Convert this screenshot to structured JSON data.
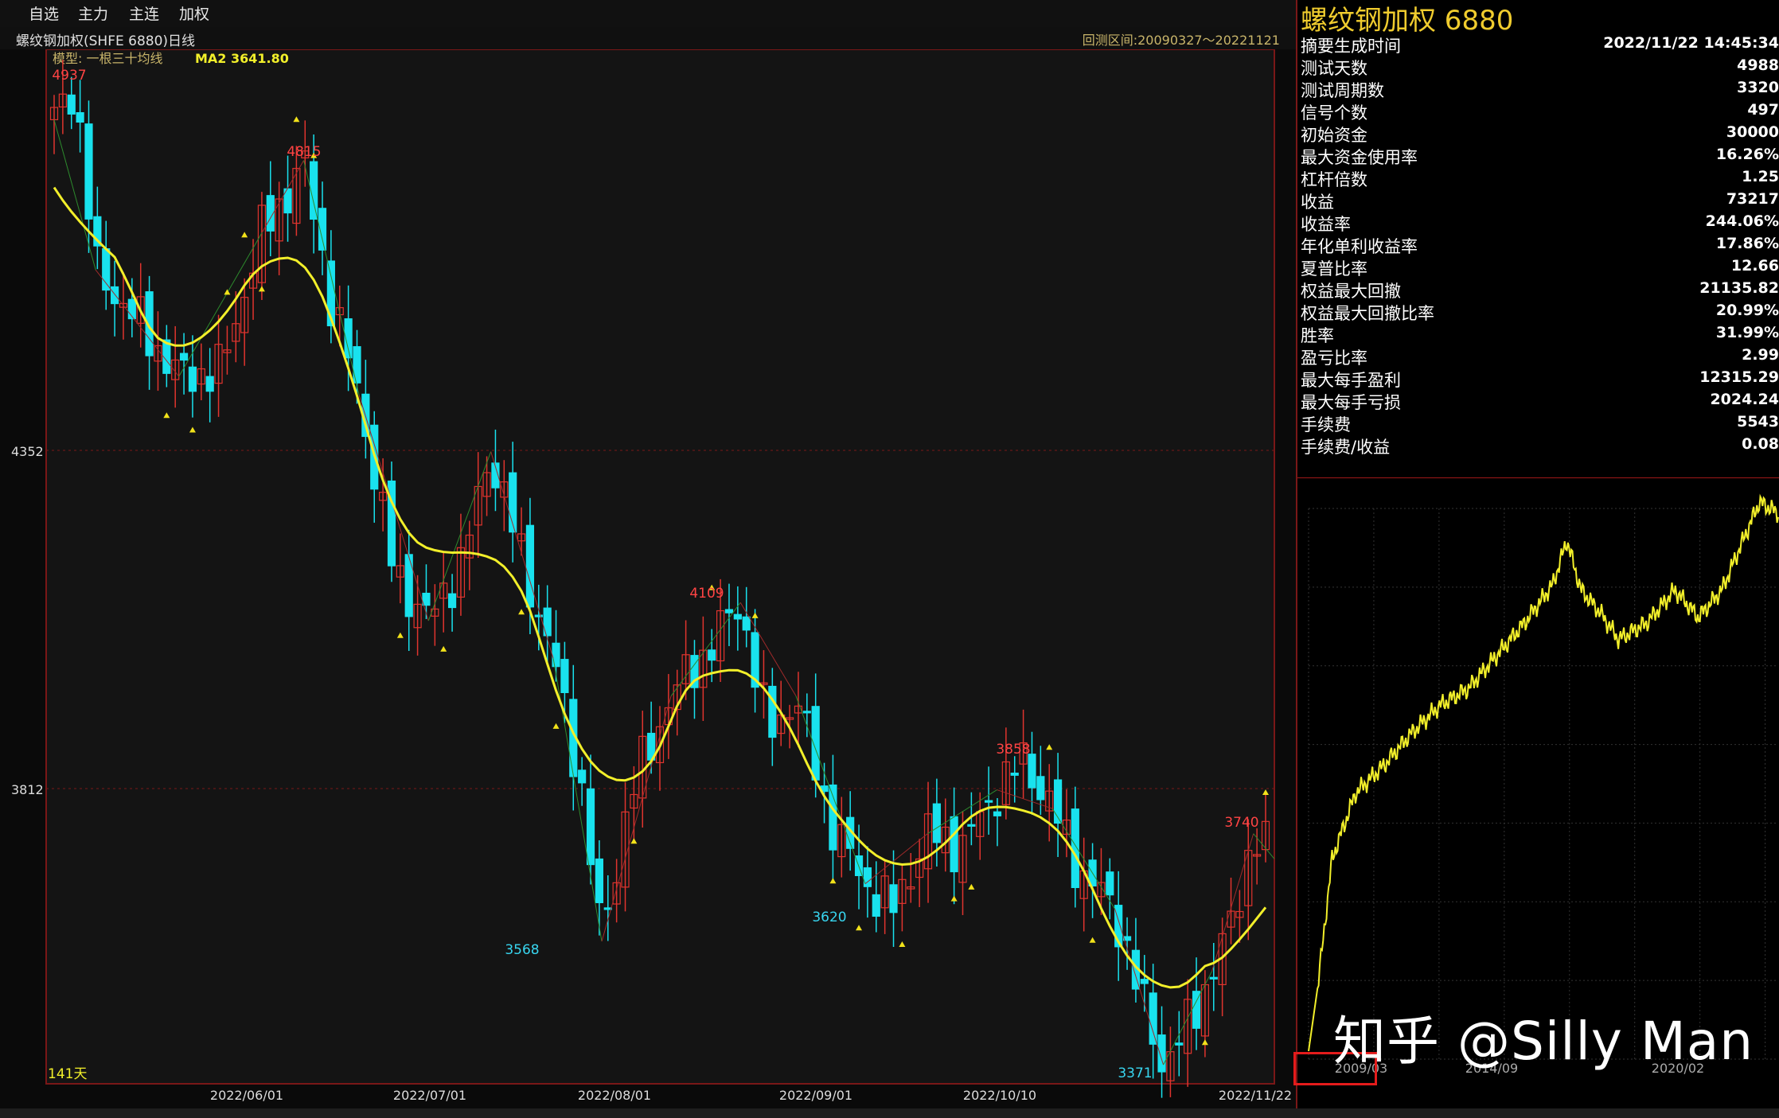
{
  "menu": {
    "items": [
      "自选",
      "主力",
      "主连",
      "加权"
    ]
  },
  "chart_header": {
    "title": "螺纹钢加权(SHFE 6880)日线",
    "range": "回测区间:20090327～20221121"
  },
  "chart_legend": {
    "model": "模型: 一根三十均线",
    "ma": "MA2 3641.80"
  },
  "chart_footer": {
    "days": "141天"
  },
  "chart_data": {
    "type": "candlestick",
    "x_ticks": [
      "2022/06/01",
      "2022/07/01",
      "2022/08/01",
      "2022/09/01",
      "2022/10/10",
      "2022/11/22"
    ],
    "y_ticks": [
      4352,
      3812
    ],
    "extremes": [
      {
        "label": "4937",
        "kind": "high",
        "value": 4937
      },
      {
        "label": "4815",
        "kind": "high",
        "value": 4815
      },
      {
        "label": "3568",
        "kind": "low",
        "value": 3568
      },
      {
        "label": "4109",
        "kind": "high",
        "value": 4109
      },
      {
        "label": "3620",
        "kind": "low",
        "value": 3620
      },
      {
        "label": "3858",
        "kind": "high",
        "value": 3858
      },
      {
        "label": "3371",
        "kind": "low",
        "value": 3371
      },
      {
        "label": "3740",
        "kind": "high",
        "value": 3740
      }
    ],
    "ma_label": "MA2",
    "ma_last": 3641.8,
    "colors": {
      "up": "#e0342e",
      "down": "#19e2ee",
      "ma": "#f2ef2a",
      "signal": "#f2e21a",
      "low_label": "#38d6f0",
      "high_label": "#ff4444"
    }
  },
  "panel": {
    "title": "螺纹钢加权  6880",
    "stats": [
      {
        "label": "摘要生成时间",
        "value": "2022/11/22 14:45:34"
      },
      {
        "label": "测试天数",
        "value": "4988"
      },
      {
        "label": "测试周期数",
        "value": "3320"
      },
      {
        "label": "信号个数",
        "value": "497"
      },
      {
        "label": "初始资金",
        "value": "30000"
      },
      {
        "label": "最大资金使用率",
        "value": "16.26%"
      },
      {
        "label": "杠杆倍数",
        "value": "1.25"
      },
      {
        "label": "收益",
        "value": "73217"
      },
      {
        "label": "收益率",
        "value": "244.06%"
      },
      {
        "label": "年化单利收益率",
        "value": "17.86%"
      },
      {
        "label": "夏普比率",
        "value": "12.66"
      },
      {
        "label": "权益最大回撤",
        "value": "21135.82"
      },
      {
        "label": "权益最大回撤比率",
        "value": "20.99%"
      },
      {
        "label": "胜率",
        "value": "31.99%"
      },
      {
        "label": "盈亏比率",
        "value": "2.99"
      },
      {
        "label": "最大每手盈利",
        "value": "12315.29"
      },
      {
        "label": "最大每手亏损",
        "value": "2024.24"
      },
      {
        "label": "手续费",
        "value": "5543"
      },
      {
        "label": "手续费/收益",
        "value": "0.08"
      }
    ],
    "equity_chart": {
      "type": "line",
      "x_ticks": [
        "2009/03",
        "2014/09",
        "2020/02"
      ],
      "color": "#f2ef2a"
    }
  },
  "watermark": "知乎 @Silly Man"
}
